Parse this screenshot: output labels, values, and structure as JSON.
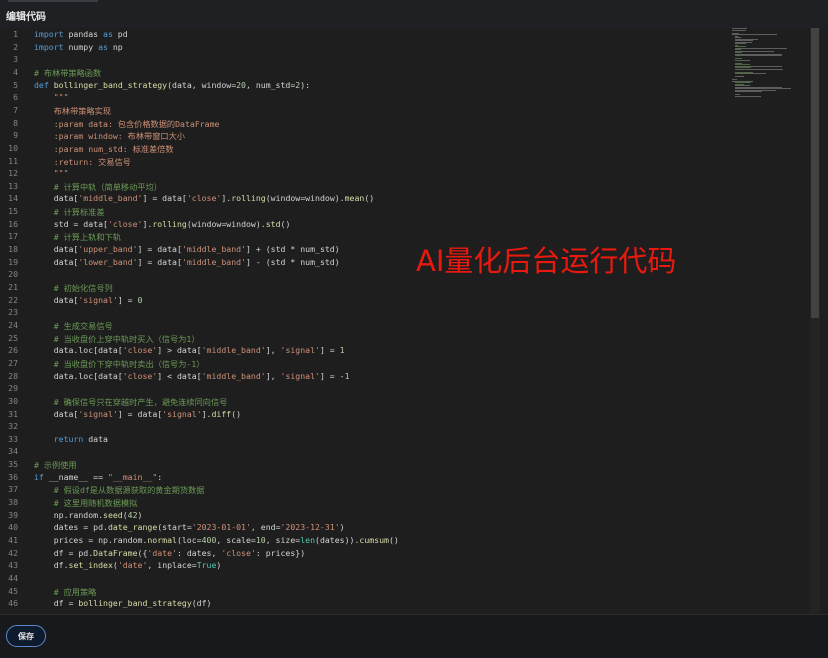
{
  "header": {
    "title": "编辑代码"
  },
  "editor": {
    "lines": [
      {
        "n": "1",
        "text": "import pandas as pd"
      },
      {
        "n": "2",
        "text": "import numpy as np"
      },
      {
        "n": "3",
        "text": ""
      },
      {
        "n": "4",
        "text": "# 布林带策略函数"
      },
      {
        "n": "5",
        "text": "def bollinger_band_strategy(data, window=20, num_std=2):"
      },
      {
        "n": "6",
        "text": "    \"\"\""
      },
      {
        "n": "7",
        "text": "    布林带策略实现"
      },
      {
        "n": "8",
        "text": "    :param data: 包含价格数据的DataFrame"
      },
      {
        "n": "9",
        "text": "    :param window: 布林带窗口大小"
      },
      {
        "n": "10",
        "text": "    :param num_std: 标准差倍数"
      },
      {
        "n": "11",
        "text": "    :return: 交易信号"
      },
      {
        "n": "12",
        "text": "    \"\"\""
      },
      {
        "n": "13",
        "text": "    # 计算中轨（简单移动平均）"
      },
      {
        "n": "14",
        "text": "    data['middle_band'] = data['close'].rolling(window=window).mean()"
      },
      {
        "n": "15",
        "text": "    # 计算标准差"
      },
      {
        "n": "16",
        "text": "    std = data['close'].rolling(window=window).std()"
      },
      {
        "n": "17",
        "text": "    # 计算上轨和下轨"
      },
      {
        "n": "18",
        "text": "    data['upper_band'] = data['middle_band'] + (std * num_std)"
      },
      {
        "n": "19",
        "text": "    data['lower_band'] = data['middle_band'] - (std * num_std)"
      },
      {
        "n": "20",
        "text": ""
      },
      {
        "n": "21",
        "text": "    # 初始化信号列"
      },
      {
        "n": "22",
        "text": "    data['signal'] = 0"
      },
      {
        "n": "23",
        "text": ""
      },
      {
        "n": "24",
        "text": "    # 生成交易信号"
      },
      {
        "n": "25",
        "text": "    # 当收盘价上穿中轨时买入（信号为1）"
      },
      {
        "n": "26",
        "text": "    data.loc[data['close'] > data['middle_band'], 'signal'] = 1"
      },
      {
        "n": "27",
        "text": "    # 当收盘价下穿中轨时卖出（信号为-1）"
      },
      {
        "n": "28",
        "text": "    data.loc[data['close'] < data['middle_band'], 'signal'] = -1"
      },
      {
        "n": "29",
        "text": ""
      },
      {
        "n": "30",
        "text": "    # 确保信号只在穿越时产生，避免连续同向信号"
      },
      {
        "n": "31",
        "text": "    data['signal'] = data['signal'].diff()"
      },
      {
        "n": "32",
        "text": ""
      },
      {
        "n": "33",
        "text": "    return data"
      },
      {
        "n": "34",
        "text": ""
      },
      {
        "n": "35",
        "text": "# 示例使用"
      },
      {
        "n": "36",
        "text": "if __name__ == \"__main__\":"
      },
      {
        "n": "37",
        "text": "    # 假设df是从数据源获取的黄金期货数据"
      },
      {
        "n": "38",
        "text": "    # 这里用随机数据模拟"
      },
      {
        "n": "39",
        "text": "    np.random.seed(42)"
      },
      {
        "n": "40",
        "text": "    dates = pd.date_range(start='2023-01-01', end='2023-12-31')"
      },
      {
        "n": "41",
        "text": "    prices = np.random.normal(loc=400, scale=10, size=len(dates)).cumsum()"
      },
      {
        "n": "42",
        "text": "    df = pd.DataFrame({'date': dates, 'close': prices})"
      },
      {
        "n": "43",
        "text": "    df.set_index('date', inplace=True)"
      },
      {
        "n": "44",
        "text": ""
      },
      {
        "n": "45",
        "text": "    # 应用策略"
      },
      {
        "n": "46",
        "text": "    df = bollinger_band_strategy(df)"
      }
    ]
  },
  "overlay": {
    "text": "AI量化后台运行代码"
  },
  "footer": {
    "save_label": "保存"
  },
  "colors": {
    "keyword": "#569cd6",
    "function": "#dcdcaa",
    "string": "#ce9178",
    "number": "#b5cea8",
    "comment": "#6a9955",
    "builtin": "#4ec9b0",
    "overlay": "#e8190f",
    "accent": "#5b88c9"
  }
}
